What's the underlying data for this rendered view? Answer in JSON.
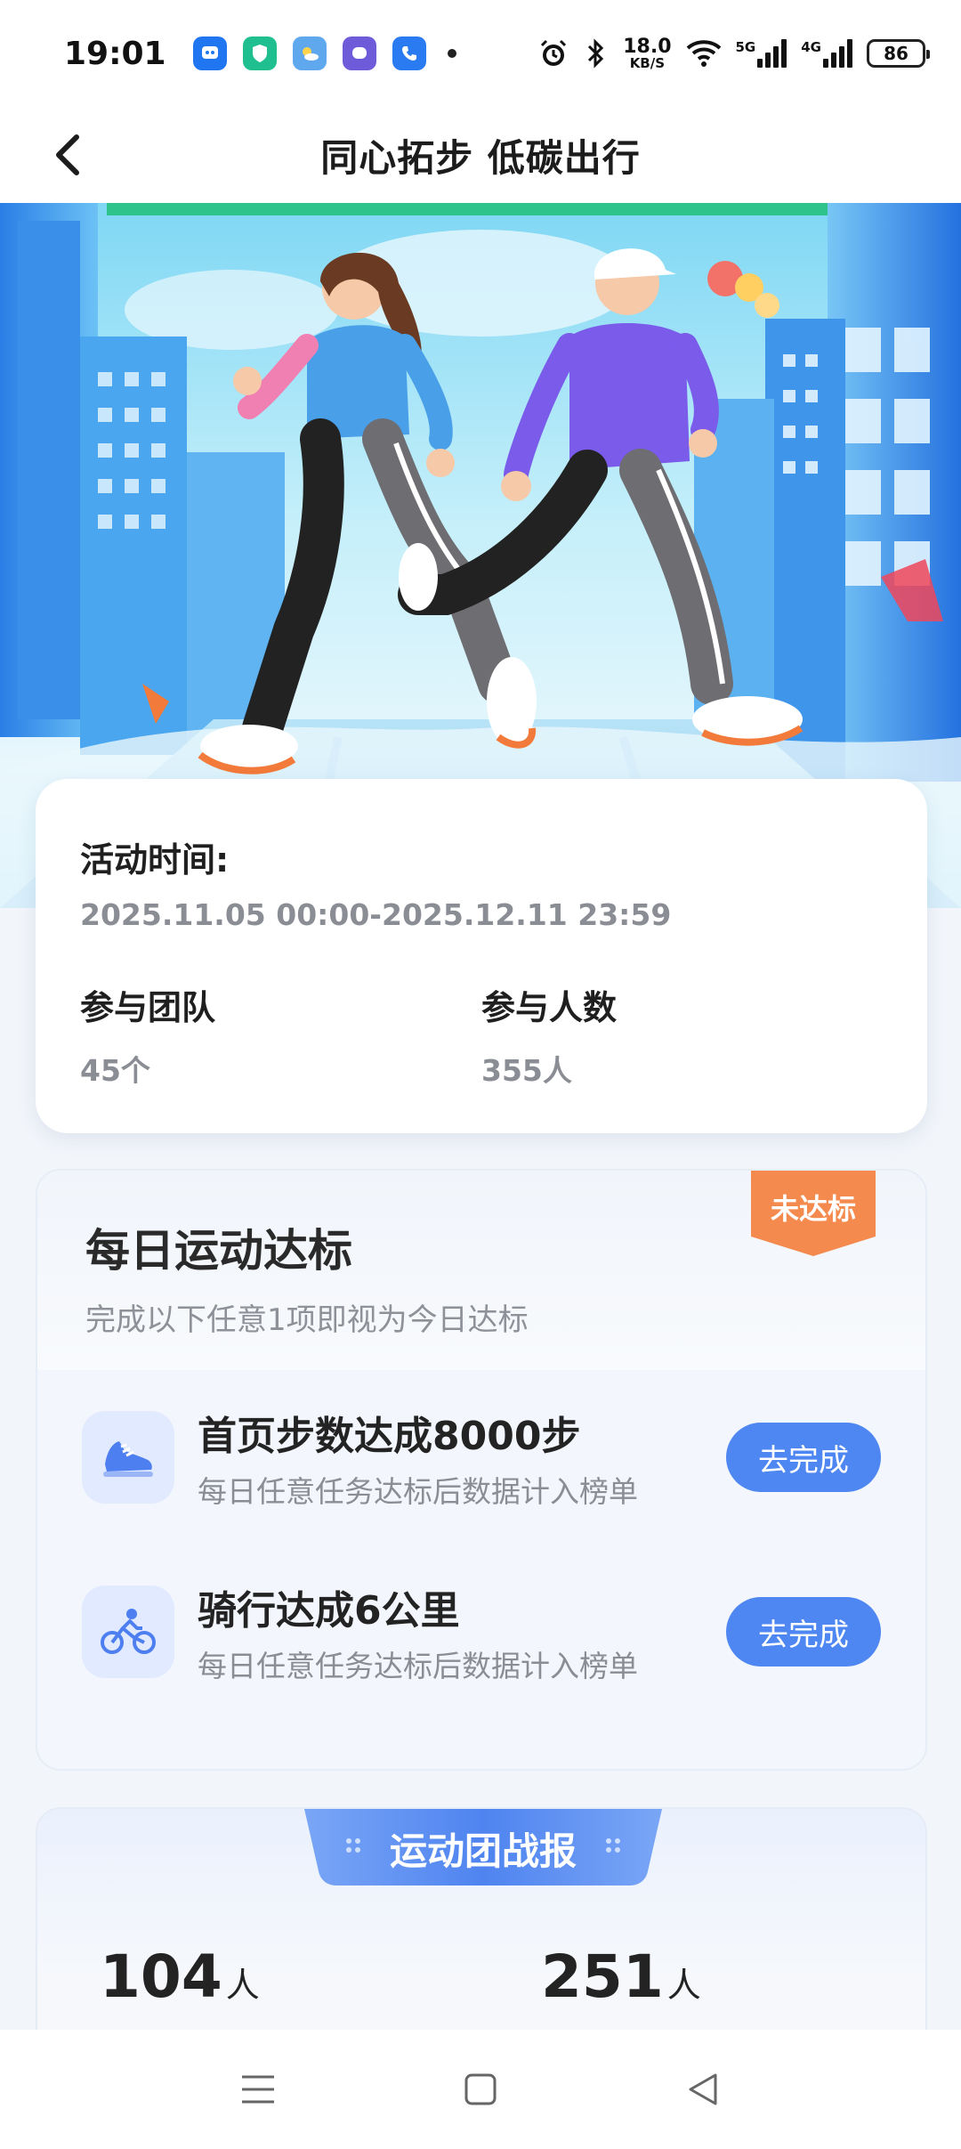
{
  "status_bar": {
    "time": "19:01",
    "network_speed": "18.0",
    "network_speed_unit": "KB/S",
    "signal_1_label": "5G",
    "signal_2_label": "4G",
    "battery": "86"
  },
  "header": {
    "title": "同心拓步 低碳出行"
  },
  "activity_info": {
    "time_label": "活动时间:",
    "time_value": "2025.11.05 00:00-2025.12.11 23:59",
    "teams_label": "参与团队",
    "teams_value": "45个",
    "participants_label": "参与人数",
    "participants_value": "355人"
  },
  "daily_goal": {
    "title": "每日运动达标",
    "subtitle": "完成以下任意1项即视为今日达标",
    "status_badge": "未达标",
    "tasks": [
      {
        "title": "首页步数达成8000步",
        "desc": "每日任意任务达标后数据计入榜单",
        "button": "去完成",
        "icon": "sneaker-icon"
      },
      {
        "title": "骑行达成6公里",
        "desc": "每日任意任务达标后数据计入榜单",
        "button": "去完成",
        "icon": "cycling-icon"
      }
    ]
  },
  "battle_report": {
    "title": "运动团战报",
    "stat_1_value": "104",
    "stat_1_unit": "人",
    "stat_2_value": "251",
    "stat_2_unit": "人"
  },
  "colors": {
    "accent": "#4e86f2",
    "badge": "#f58a4e",
    "text_secondary": "#8a8d94"
  }
}
